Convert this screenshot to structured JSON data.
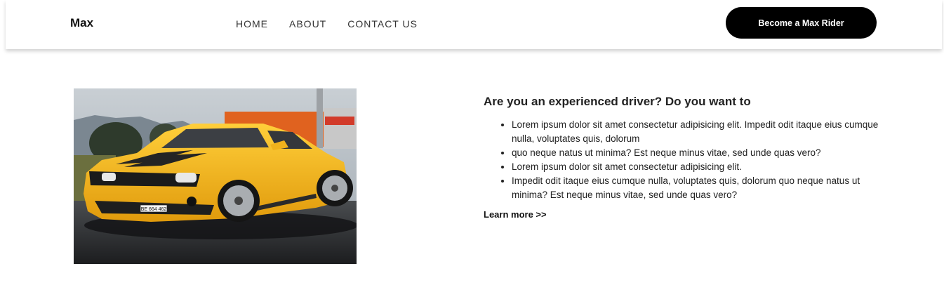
{
  "header": {
    "brand": "Max",
    "nav": [
      "HOME",
      "ABOUT",
      "CONTACT US"
    ],
    "cta_label": "Become a Max Rider"
  },
  "main": {
    "image_plate_text": "BE 664 462",
    "heading": "Are you an experienced driver? Do you want to",
    "bullets": [
      "Lorem ipsum dolor sit amet consectetur adipisicing elit. Impedit odit itaque eius cumque nulla, voluptates quis, dolorum",
      "quo neque natus ut minima? Est neque minus vitae, sed unde quas vero?",
      "Lorem ipsum dolor sit amet consectetur adipisicing elit.",
      "Impedit odit itaque eius cumque nulla, voluptates quis, dolorum quo neque natus ut minima? Est neque minus vitae, sed unde quas vero?"
    ],
    "learn_more": "Learn more >>"
  },
  "colors": {
    "cta_bg": "#000000",
    "car_yellow": "#f7b81d"
  }
}
